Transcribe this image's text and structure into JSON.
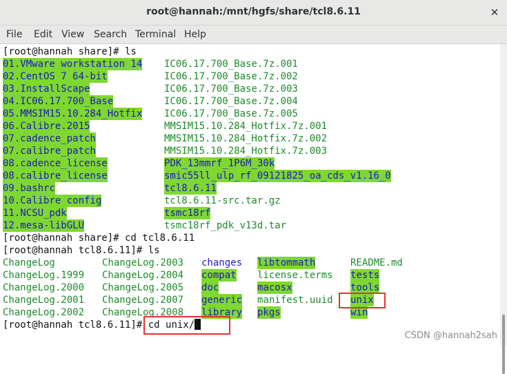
{
  "window": {
    "title": "root@hannah:/mnt/hgfs/share/tcl8.6.11"
  },
  "menu": [
    "File",
    "Edit",
    "View",
    "Search",
    "Terminal",
    "Help"
  ],
  "icons": {
    "close": "close-icon"
  },
  "colors": {
    "dir_bg": "#7fd731",
    "dir_fg": "#1a1ab8",
    "exec_fg": "#1e8a2a",
    "highlight_box": "#e5312f"
  },
  "terminal": {
    "prompt1": "[root@hannah share]# ls",
    "listing1": [
      [
        "01.VMware workstation 14",
        "IC06.17.700_Base.7z.001"
      ],
      [
        "02.CentOS 7 64-bit",
        "IC06.17.700_Base.7z.002"
      ],
      [
        "03.InstallScape",
        "IC06.17.700_Base.7z.003"
      ],
      [
        "04.IC06.17.700_Base",
        "IC06.17.700_Base.7z.004"
      ],
      [
        "05.MMSIM15.10.284_Hotfix",
        "IC06.17.700_Base.7z.005"
      ],
      [
        "06.Calibre.2015",
        "MMSIM15.10.284_Hotfix.7z.001"
      ],
      [
        "07.cadence_patch",
        "MMSIM15.10.284_Hotfix.7z.002"
      ],
      [
        "07.calibre_patch",
        "MMSIM15.10.284_Hotfix.7z.003"
      ],
      [
        "08.cadence_license",
        "PDK_13mmrf_1P6M_30k"
      ],
      [
        "08.calibre_license",
        "smic55ll_ulp_rf_09121825_oa_cds_v1.16_0"
      ],
      [
        "09.bashrc",
        "tcl8.6.11"
      ],
      [
        "10.Calibre config",
        "tcl8.6.11-src.tar.gz"
      ],
      [
        "11.NCSU_pdk",
        "tsmc18rf"
      ],
      [
        "12.mesa-libGLU",
        "tsmc18rf_pdk_v13d.tar"
      ]
    ],
    "prompt2": "[root@hannah share]# cd tcl8.6.11",
    "prompt3": "[root@hannah tcl8.6.11]# ls",
    "listing2": [
      [
        "ChangeLog",
        "ChangeLog.2003",
        "changes",
        "libtommath",
        "README.md"
      ],
      [
        "ChangeLog.1999",
        "ChangeLog.2004",
        "compat",
        "license.terms",
        "tests"
      ],
      [
        "ChangeLog.2000",
        "ChangeLog.2005",
        "doc",
        "macosx",
        "tools"
      ],
      [
        "ChangeLog.2001",
        "ChangeLog.2007",
        "generic",
        "manifest.uuid",
        "unix"
      ],
      [
        "ChangeLog.2002",
        "ChangeLog.2008",
        "library",
        "pkgs",
        "win"
      ]
    ],
    "prompt4_head": "[root@hannah tcl8.6.11]",
    "prompt4_cmd": "# cd unix/"
  },
  "watermark": "CSDN @hannah2sah"
}
